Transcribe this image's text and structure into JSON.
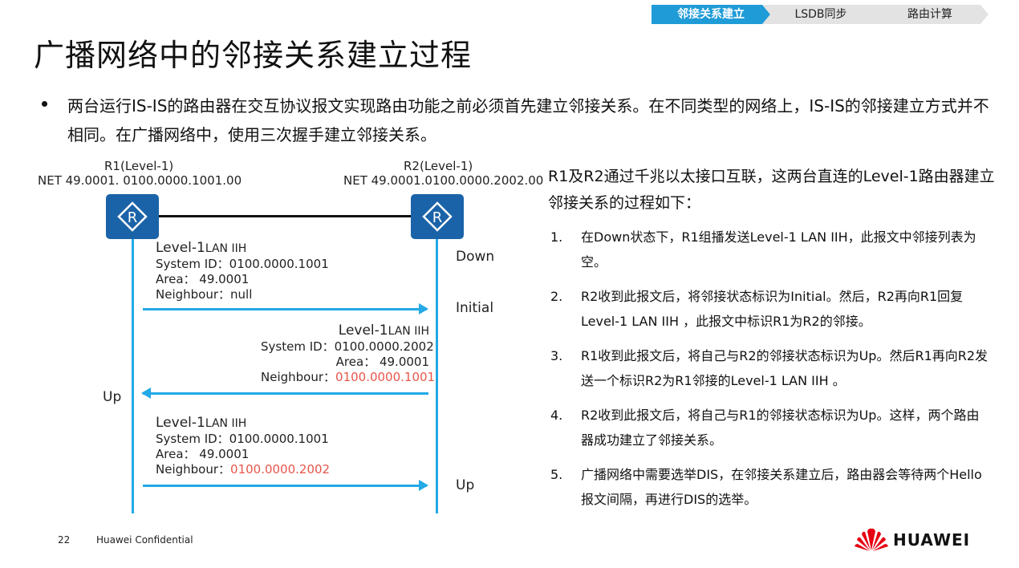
{
  "nav": {
    "steps": [
      "邻接关系建立",
      "LSDB同步",
      "路由计算"
    ],
    "active_color": "#1f9bd7"
  },
  "title": "广播网络中的邻接关系建立过程",
  "intro": "两台运行IS-IS的路由器在交互协议报文实现路由功能之前必须首先建立邻接关系。在不同类型的网络上，IS-IS的邻接建立方式并不相同。在广播网络中，使用三次握手建立邻接关系。",
  "diagram": {
    "r1": {
      "name": "R1(Level-1)",
      "net": "NET 49.0001. 0100.0000.1001.00"
    },
    "r2": {
      "name": "R2(Level-1)",
      "net": "NET 49.0001.0100.0000.2002.00"
    },
    "router_icon": "router-icon",
    "messages": [
      {
        "hd_main": "Level-1",
        "hd_sub": "LAN IIH",
        "system_id": "System ID：0100.0000.1001",
        "area": "Area：  49.0001",
        "neighbour_label": "Neighbour：",
        "neighbour_value": "null"
      },
      {
        "hd_main": "Level-1",
        "hd_sub": "LAN IIH",
        "system_id": "System ID：0100.0000.2002",
        "area": "Area：  49.0001",
        "neighbour_label": "Neighbour：",
        "neighbour_value": "0100.0000.1001"
      },
      {
        "hd_main": "Level-1",
        "hd_sub": "LAN IIH",
        "system_id": "System ID：0100.0000.1001",
        "area": "Area：  49.0001",
        "neighbour_label": "Neighbour：",
        "neighbour_value": "0100.0000.2002"
      }
    ],
    "states": {
      "r2_down": "Down",
      "r2_initial": "Initial",
      "r1_up": "Up",
      "r2_up": "Up"
    },
    "line_color": "#23a9e6",
    "highlight_color": "#e8564a"
  },
  "description": {
    "intro": "R1及R2通过千兆以太接口互联，这两台直连的Level-1路由器建立邻接关系的过程如下：",
    "steps": [
      {
        "num": "1.",
        "text": "在Down状态下，R1组播发送Level-1 LAN IIH，此报文中邻接列表为空。"
      },
      {
        "num": "2.",
        "text": "R2收到此报文后，将邻接状态标识为Initial。然后，R2再向R1回复Level-1 LAN IIH ，此报文中标识R1为R2的邻接。"
      },
      {
        "num": "3.",
        "text": "R1收到此报文后，将自己与R2的邻接状态标识为Up。然后R1再向R2发送一个标识R2为R1邻接的Level-1 LAN IIH 。"
      },
      {
        "num": "4.",
        "text": "R2收到此报文后，将自己与R1的邻接状态标识为Up。这样，两个路由器成功建立了邻接关系。"
      },
      {
        "num": "5.",
        "text": "广播网络中需要选举DIS，在邻接关系建立后，路由器会等待两个Hello报文间隔，再进行DIS的选举。"
      }
    ]
  },
  "footer": {
    "page_number": "22",
    "confidential": "Huawei Confidential",
    "brand": "HUAWEI",
    "logo_icon": "huawei-logo-icon",
    "brand_color": "#e60012"
  }
}
